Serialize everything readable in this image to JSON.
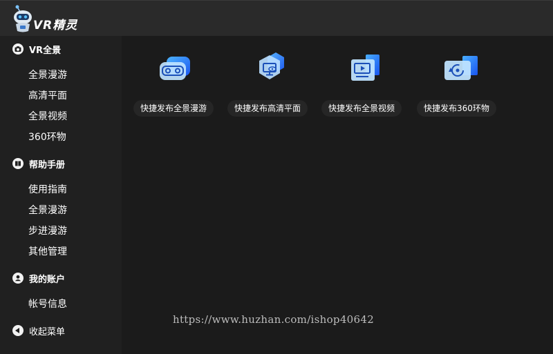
{
  "app": {
    "logo_text": "VR精灵"
  },
  "sidebar": {
    "groups": [
      {
        "title": "VR全景",
        "icon": "camera-icon",
        "items": [
          "全景漫游",
          "高清平面",
          "全景视频",
          "360环物"
        ]
      },
      {
        "title": "帮助手册",
        "icon": "book-icon",
        "items": [
          "使用指南",
          "全景漫游",
          "步进漫游",
          "其他管理"
        ]
      },
      {
        "title": "我的账户",
        "icon": "user-icon",
        "items": [
          "帐号信息"
        ]
      }
    ],
    "collapse_label": "收起菜单"
  },
  "main": {
    "tiles": [
      {
        "label": "快捷发布全景漫游",
        "icon": "vr-headset-icon"
      },
      {
        "label": "快捷发布高清平面",
        "icon": "eye-monitor-icon"
      },
      {
        "label": "快捷发布全景视频",
        "icon": "video-play-icon"
      },
      {
        "label": "快捷发布360环物",
        "icon": "rotate-360-icon"
      }
    ]
  },
  "watermark": "https://www.huzhan.com/ishop40642",
  "colors": {
    "accent": "#1e6bff",
    "accent_light": "#5aa8ff",
    "sidebar_bg": "#202020",
    "main_bg": "#1b1b1b"
  }
}
